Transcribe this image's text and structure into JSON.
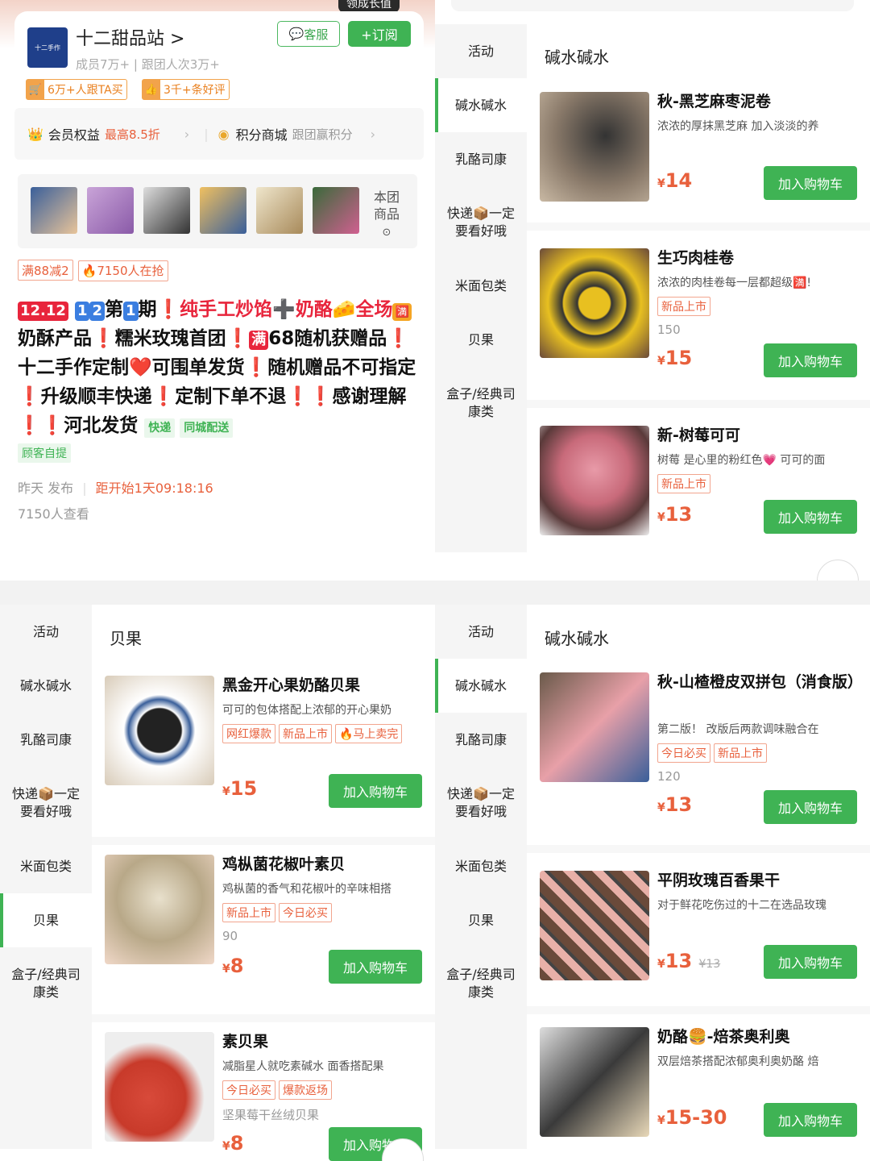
{
  "shop": {
    "name": "十二甜品站 >",
    "meta": "成员7万+ | 跟团人次3万+",
    "badge_top": "领成长值",
    "service_label": "客服",
    "subscribe_label": "+订阅",
    "tag1": "6万+人跟TA买",
    "tag2": "3千+条好评",
    "rights_label": "会员权益",
    "rights_value": "最高8.5折",
    "points_label": "积分商城",
    "points_value": "跟团赢积分",
    "group_goods": "本团商品"
  },
  "post": {
    "chip1": "满88减2",
    "chip2": "7150人在抢",
    "desc_parts": [
      "12.12",
      "1",
      "2",
      "第",
      "1",
      "期",
      "❗纯手工炒馅➕奶酪🧀全场",
      "🈵",
      "奶酥产品❗糯米玫瑰首团❗",
      "满",
      "68随机获赠品❗十二手作定制❤️可围单发货❗随机赠品不可指定❗升级顺丰快递❗定制下单不退❗❗感谢理解❗❗河北发货"
    ],
    "tag_express": "快递",
    "tag_city": "同城配送",
    "tag_pickup": "顾客自提",
    "time_posted": "昨天 发布",
    "countdown": "距开始1天09:18:16",
    "views": "7150人查看"
  },
  "categories": [
    "活动",
    "碱水碱水",
    "乳酪司康",
    "快递📦一定要看好哦",
    "米面包类",
    "贝果",
    "盒子/经典司康类"
  ],
  "add_cart_label": "加入购物车",
  "panel_top_right": {
    "heading": "碱水碱水",
    "products": [
      {
        "name": "秋-黑芝麻枣泥卷",
        "desc": "浓浓的厚抹黑芝麻 加入淡淡的养",
        "tags": [],
        "sales": "",
        "price": "14",
        "old": ""
      },
      {
        "name": "生巧肉桂卷",
        "desc": "浓浓的肉桂卷每一层都超级🈵!",
        "tags": [
          "新品上市"
        ],
        "sales": "150",
        "price": "15",
        "old": ""
      },
      {
        "name": "新-树莓可可",
        "desc": "树莓 是心里的粉红色💗 可可的面",
        "tags": [
          "新品上市"
        ],
        "sales": "",
        "price": "13",
        "old": ""
      }
    ]
  },
  "panel_bottom_left": {
    "heading": "贝果",
    "products": [
      {
        "name": "黑金开心果奶酪贝果",
        "desc": "可可的包体搭配上浓郁的开心果奶",
        "tags": [
          "网红爆款",
          "新品上市",
          "🔥马上卖完"
        ],
        "sales": "",
        "price": "15",
        "old": ""
      },
      {
        "name": "鸡枞菌花椒叶素贝",
        "desc": "鸡枞菌的香气和花椒叶的辛味相搭",
        "tags": [
          "新品上市",
          "今日必买"
        ],
        "sales": "90",
        "price": "8",
        "old": ""
      },
      {
        "name": "素贝果",
        "desc": "减脂星人就吃素碱水 面香搭配果",
        "tags": [
          "今日必买",
          "爆款返场"
        ],
        "sales": "坚果莓干丝绒贝果",
        "price": "8",
        "old": ""
      }
    ]
  },
  "panel_bottom_right": {
    "heading": "碱水碱水",
    "products": [
      {
        "name": "秋-山楂橙皮双拼包（消食版）",
        "desc": "第二版！ 改版后两款调味融合在",
        "tags": [
          "今日必买",
          "新品上市"
        ],
        "sales": "120",
        "price": "13",
        "old": ""
      },
      {
        "name": "平阴玫瑰百香果干",
        "desc": "对于鲜花吃伤过的十二在选品玫瑰",
        "tags": [],
        "sales": "",
        "price": "13",
        "old": "¥13"
      },
      {
        "name": "奶酪🍔-焙茶奥利奥",
        "desc": "双层焙茶搭配浓郁奥利奥奶酪 焙",
        "tags": [],
        "sales": "",
        "price": "15-30",
        "old": ""
      }
    ]
  },
  "currency": "¥",
  "colors": {
    "green": "#3fb354",
    "orange": "#e8603c",
    "red": "#e8253c"
  }
}
